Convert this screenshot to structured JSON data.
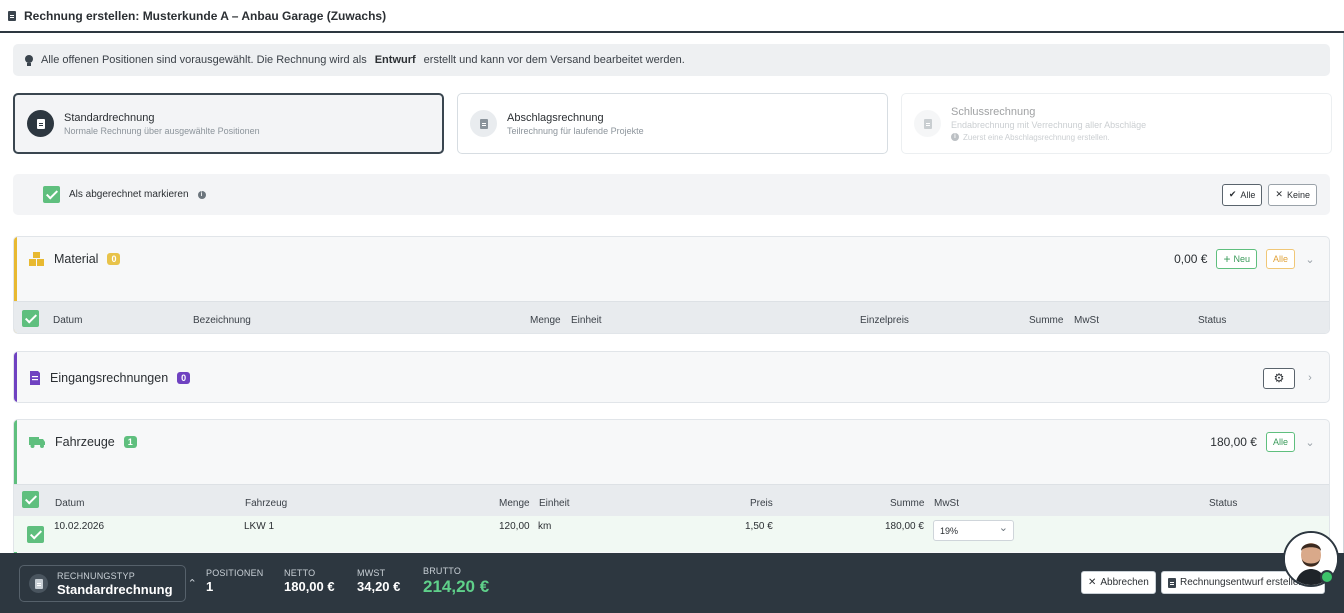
{
  "window": {
    "title": "Rechnung erstellen: Musterkunde A – Anbau Garage (Zuwachs)"
  },
  "info": {
    "text_before": "Alle offenen Positionen sind vorausgewählt. Die Rechnung wird als",
    "highlight": "Entwurf",
    "text_after": "erstellt und kann vor dem Versand bearbeitet werden."
  },
  "types": [
    {
      "name": "Standardrechnung",
      "desc": "Normale Rechnung über ausgewählte Positionen"
    },
    {
      "name": "Abschlagsrechnung",
      "desc": "Teilrechnung für laufende Projekte"
    },
    {
      "name": "Schlussrechnung",
      "desc": "Endabrechnung mit Verrechnung aller Abschläge",
      "hint": "Zuerst eine Abschlagsrechnung erstellen."
    }
  ],
  "mark": {
    "label": "Als abgerechnet markieren",
    "all": "Alle",
    "none": "Keine"
  },
  "material": {
    "title": "Material",
    "count": "0",
    "amount": "0,00 €",
    "new": "Neu",
    "all": "Alle",
    "columns": [
      "Datum",
      "Bezeichnung",
      "Menge",
      "Einheit",
      "Einzelpreis",
      "Summe",
      "MwSt",
      "Status"
    ]
  },
  "eingang": {
    "title": "Eingangsrechnungen",
    "count": "0"
  },
  "fahrzeuge": {
    "title": "Fahrzeuge",
    "count": "1",
    "amount": "180,00 €",
    "all": "Alle",
    "columns": [
      "Datum",
      "Fahrzeug",
      "Menge",
      "Einheit",
      "Preis",
      "Summe",
      "MwSt",
      "Status"
    ],
    "rows": [
      {
        "date": "10.02.2026",
        "vehicle": "LKW 1",
        "qty": "120,00",
        "unit": "km",
        "price": "1,50 €",
        "sum": "180,00 €",
        "vat": "19%"
      }
    ]
  },
  "footer": {
    "type_label": "RECHNUNGSTYP",
    "type_value": "Standardrechnung",
    "pos_label": "POSITIONEN",
    "pos_value": "1",
    "netto_label": "NETTO",
    "netto_value": "180,00 €",
    "mwst_label": "MWST",
    "mwst_value": "34,20 €",
    "brutto_label": "BRUTTO",
    "brutto_value": "214,20 €",
    "cancel": "Abbrechen",
    "create": "Rechnungsentwurf erstellen"
  },
  "colors": {
    "dark": "#2d3740",
    "green": "#5fbf7e",
    "material": "#e8b931",
    "eingang": "#6f42c1",
    "brutto": "#5fd08a"
  }
}
